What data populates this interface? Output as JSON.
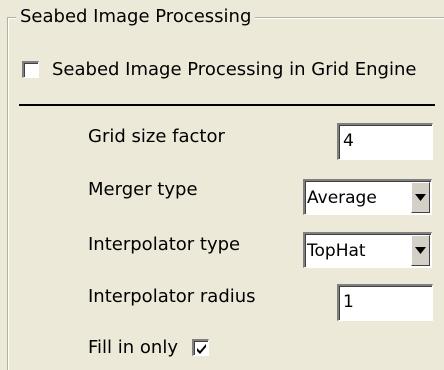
{
  "group": {
    "title": "Seabed Image Processing"
  },
  "enable_option": {
    "label": "Seabed Image Processing in Grid Engine",
    "checked": false
  },
  "fields": {
    "grid_size_factor": {
      "label": "Grid size factor",
      "value": "4"
    },
    "merger_type": {
      "label": "Merger type",
      "selected": "Average"
    },
    "interpolator_type": {
      "label": "Interpolator type",
      "selected": "TopHat"
    },
    "interpolator_radius": {
      "label": "Interpolator radius",
      "value": "1"
    },
    "fill_in_only": {
      "label": "Fill in only",
      "checked": true
    }
  },
  "icons": {
    "checkmark": "checkmark-icon",
    "dropdown_arrow": "chevron-down-icon"
  },
  "colors": {
    "window_background": "#ece9d8",
    "field_background": "#ffffff",
    "button_face": "#d4d0c8"
  }
}
